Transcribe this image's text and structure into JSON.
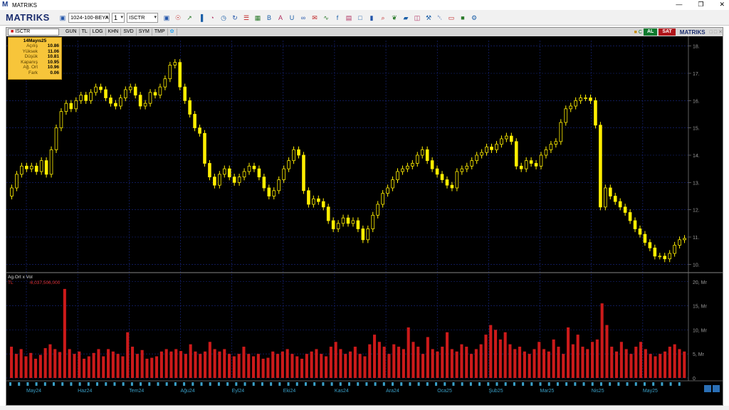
{
  "window": {
    "title": "MATRIKS",
    "logo": "M"
  },
  "toolbar": {
    "brand": "MATRIKS",
    "layout_combo": "1024-100-BEYA",
    "window_number": "1",
    "symbol_combo": "ISCTR",
    "icons": [
      "save-icon",
      "zoom-icon",
      "drawing-icon",
      "chart-type-icon",
      "pie-icon",
      "clock-icon",
      "refresh-icon",
      "list-icon",
      "calculator-icon",
      "bold-icon",
      "font-icon",
      "underline-icon",
      "link-icon",
      "news-icon",
      "analysis-icon",
      "function-icon",
      "table-icon",
      "window-icon",
      "book-icon",
      "search-icon",
      "twitter-icon",
      "note-icon",
      "layout-icon",
      "tools-icon",
      "bell-icon",
      "ruler-icon",
      "chat-icon",
      "settings-icon"
    ]
  },
  "chart_toolbar": {
    "symbol": "ISCTR",
    "tabs": [
      "GUN",
      "TL",
      "LOG",
      "KHN",
      "SVD",
      "SYM",
      "TMP"
    ],
    "buy_label": "AL",
    "sell_label": "SAT",
    "brand": "MATRIKS"
  },
  "infobox": {
    "date": "14Mayıs25",
    "rows": [
      {
        "label": "Açılış",
        "value": "10.86"
      },
      {
        "label": "Yüksek",
        "value": "11.06"
      },
      {
        "label": "Düşük",
        "value": "10.81"
      },
      {
        "label": "Kapanış",
        "value": "10.95"
      },
      {
        "label": "Ağ. Ort",
        "value": "10.96"
      },
      {
        "label": "Fark",
        "value": "0.06"
      }
    ]
  },
  "volume_panel": {
    "title": "Ag.Ort x Vol",
    "currency": "TL",
    "value": "-6,037,506,000"
  },
  "colors": {
    "candle": "#ffee00",
    "volume": "#cc1a1a",
    "grid": "#1a2a8a",
    "axis_text": "#9a9a9a",
    "panel_divider": "#6a6a6a"
  },
  "chart_data": [
    {
      "type": "candlestick",
      "title": "",
      "y_axis_labels": [
        "18.",
        "17.",
        "16.",
        "15.",
        "14.",
        "13.",
        "12.",
        "11.",
        "10."
      ],
      "ylim": [
        9.8,
        18.2
      ],
      "x_labels": [
        "May24",
        "Haz24",
        "Tem24",
        "Ağu24",
        "Eyl24",
        "Eki24",
        "Kas24",
        "Ara24",
        "Oca25",
        "Şub25",
        "Mar25",
        "Nis25",
        "May25"
      ],
      "close": [
        12.8,
        13.3,
        13.6,
        13.5,
        13.6,
        13.4,
        13.8,
        13.3,
        14.2,
        15.0,
        15.6,
        15.9,
        15.7,
        16.0,
        16.2,
        16.0,
        16.3,
        16.5,
        16.4,
        16.1,
        15.9,
        15.8,
        16.1,
        16.4,
        16.5,
        16.2,
        15.8,
        15.9,
        16.3,
        16.2,
        16.5,
        16.8,
        17.3,
        17.4,
        16.5,
        16.0,
        15.5,
        15.0,
        14.8,
        13.7,
        13.2,
        12.9,
        13.3,
        13.5,
        13.2,
        13.0,
        13.2,
        13.4,
        13.6,
        13.5,
        13.2,
        12.8,
        12.5,
        12.7,
        13.1,
        13.5,
        13.8,
        14.2,
        14.0,
        12.7,
        12.2,
        12.4,
        12.3,
        12.1,
        11.6,
        11.3,
        11.5,
        11.7,
        11.5,
        11.6,
        11.3,
        10.9,
        11.3,
        11.8,
        12.2,
        12.6,
        12.8,
        13.1,
        13.4,
        13.5,
        13.6,
        13.7,
        14.0,
        14.2,
        13.8,
        13.5,
        13.3,
        13.1,
        12.9,
        12.8,
        13.4,
        13.5,
        13.6,
        13.8,
        14.0,
        14.1,
        14.3,
        14.2,
        14.4,
        14.6,
        14.7,
        14.5,
        13.6,
        13.5,
        13.8,
        13.7,
        13.6,
        14.0,
        14.2,
        14.4,
        14.5,
        15.2,
        15.7,
        15.8,
        16.0,
        16.1,
        16.1,
        16.0,
        15.1,
        12.1,
        12.8,
        12.5,
        12.3,
        12.1,
        11.9,
        11.6,
        11.3,
        11.1,
        10.8,
        10.6,
        10.3,
        10.3,
        10.2,
        10.4,
        10.7,
        10.9,
        10.95
      ],
      "volume_y_axis_labels": [
        "20, Mr",
        "15, Mr",
        "10, Mr",
        "5, Mr",
        "0"
      ],
      "volume_ylim": [
        0,
        21
      ],
      "volume": [
        6.5,
        5.0,
        6.0,
        4.5,
        5.2,
        4.0,
        4.8,
        6.2,
        7.0,
        6.0,
        5.4,
        18.5,
        6.0,
        5.0,
        5.5,
        4.0,
        4.5,
        5.2,
        6.0,
        4.5,
        6.0,
        5.5,
        5.0,
        4.5,
        9.5,
        6.5,
        5.0,
        5.8,
        4.0,
        4.2,
        4.5,
        5.5,
        6.0,
        5.5,
        6.0,
        5.6,
        5.0,
        7.0,
        5.5,
        5.0,
        5.5,
        7.5,
        6.0,
        5.5,
        6.0,
        5.0,
        4.5,
        5.0,
        6.5,
        5.0,
        4.5,
        5.0,
        4.0,
        4.2,
        5.5,
        5.0,
        5.5,
        6.0,
        5.0,
        4.5,
        4.0,
        5.0,
        5.5,
        6.0,
        5.0,
        4.5,
        6.5,
        7.5,
        6.0,
        5.0,
        5.5,
        6.5,
        5.0,
        4.5,
        7.0,
        9.0,
        7.5,
        6.5,
        5.0,
        7.0,
        6.5,
        6.0,
        10.5,
        7.5,
        6.5,
        5.0,
        8.5,
        6.0,
        5.5,
        6.5,
        9.5,
        6.0,
        5.5,
        7.0,
        6.5,
        5.0,
        6.0,
        7.0,
        9.0,
        11.0,
        10.0,
        8.0,
        9.5,
        7.0,
        6.0,
        6.5,
        5.5,
        5.0,
        6.0,
        7.5,
        6.0,
        5.5,
        8.0,
        6.5,
        5.0,
        10.5,
        7.0,
        9.0,
        6.5,
        6.0,
        7.5,
        8.0,
        15.5,
        11.0,
        6.5,
        5.5,
        7.5,
        6.0,
        5.0,
        6.5,
        7.5,
        6.0,
        5.0,
        4.5,
        5.0,
        5.5,
        6.5,
        7.0,
        6.0,
        5.5
      ]
    }
  ],
  "bottom": {
    "buttons": [
      "◂",
      "▸"
    ]
  }
}
